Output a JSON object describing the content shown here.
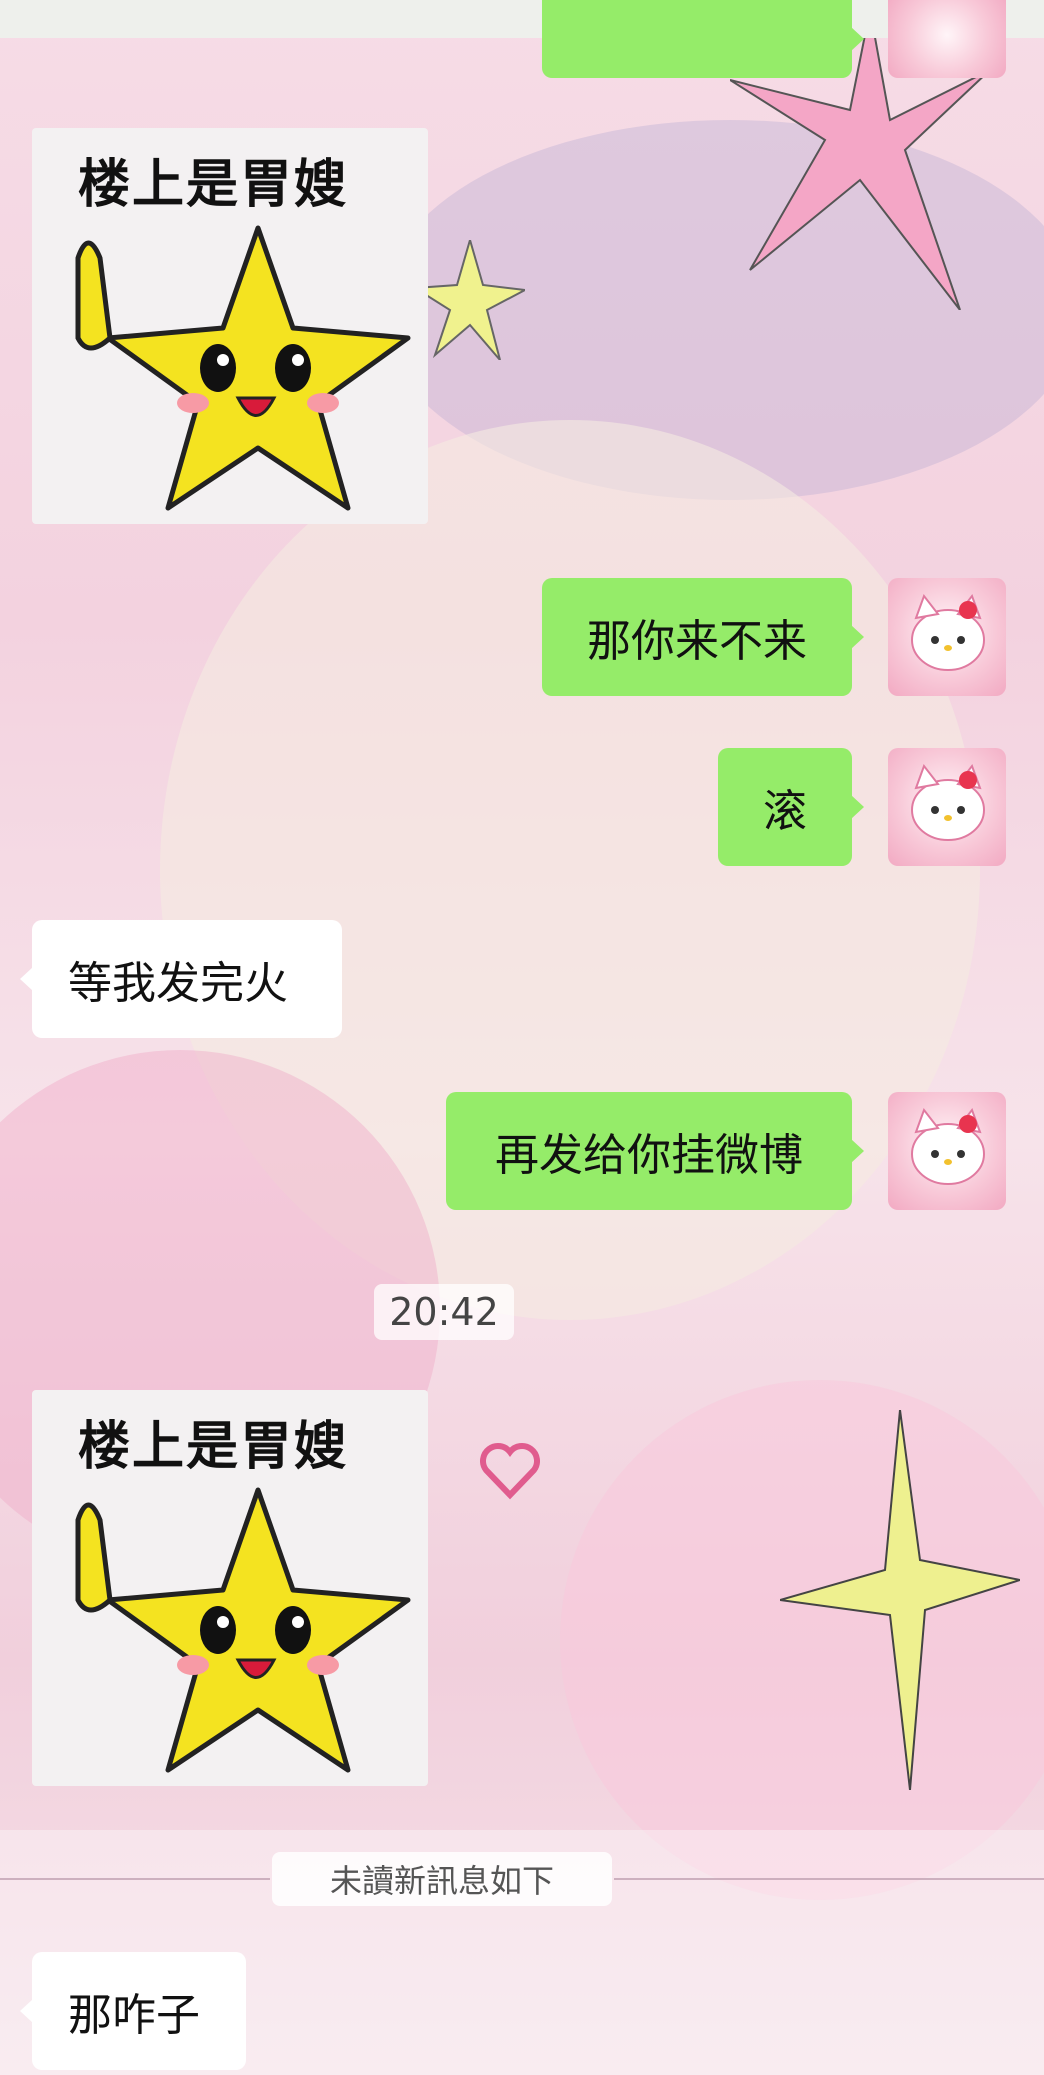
{
  "colors": {
    "outgoing_bubble": "#95ec69",
    "incoming_bubble": "#ffffff",
    "background_pink": "#f3d2df"
  },
  "messages": [
    {
      "side": "in",
      "type": "sticker",
      "caption": "楼上是胃嫂",
      "icon": "yellow-star-pointing-up"
    },
    {
      "side": "out",
      "type": "text",
      "text": "那你来不来"
    },
    {
      "side": "out",
      "type": "text",
      "text": "滚"
    },
    {
      "side": "in",
      "type": "text",
      "text": "等我发完火"
    },
    {
      "side": "out",
      "type": "text",
      "text": "再发给你挂微博"
    },
    {
      "side": "in",
      "type": "sticker",
      "caption": "楼上是胃嫂",
      "icon": "yellow-star-pointing-up"
    },
    {
      "side": "in",
      "type": "text",
      "text": "那咋子"
    }
  ],
  "timestamp": "20:42",
  "unread_divider": "未讀新訊息如下"
}
